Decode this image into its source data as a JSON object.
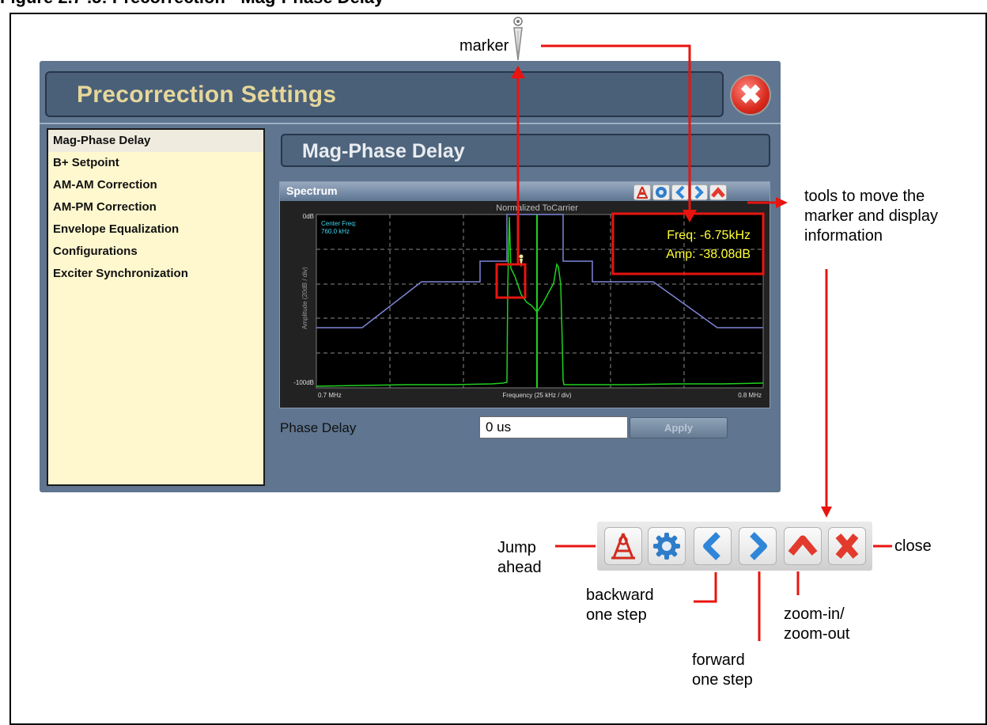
{
  "figure": {
    "title": "Figure 2.7 .5: Precorrection - Mag-Phase Delay"
  },
  "window": {
    "title": "Precorrection Settings",
    "close_glyph": "✖"
  },
  "menu": {
    "items": [
      {
        "label": "Mag-Phase Delay",
        "active": true
      },
      {
        "label": "B+ Setpoint"
      },
      {
        "label": "AM-AM Correction"
      },
      {
        "label": "AM-PM Correction"
      },
      {
        "label": "Envelope Equalization"
      },
      {
        "label": "Configurations"
      },
      {
        "label": "Exciter Synchronization"
      }
    ]
  },
  "section": {
    "title": "Mag-Phase Delay"
  },
  "spectrum": {
    "panel_title": "Spectrum",
    "plot_title": "Normalized ToCarrier",
    "center_freq_label": "Center Freq:",
    "center_freq_value": "760.0 kHz",
    "y_top": "0dB",
    "y_bottom": "-100dB",
    "y_axis_label": "Amplitude (20dB / div)",
    "x_left": "0.7 MHz",
    "x_right": "0.8 MHz",
    "x_axis_label": "Frequency (25 kHz / div)",
    "marker_freq": "Freq: -6.75kHz",
    "marker_amp": "Amp: -38.08dB"
  },
  "phase_delay": {
    "label": "Phase Delay",
    "value": "0 us",
    "apply_label": "Apply"
  },
  "annotations": {
    "marker": "marker",
    "tools": [
      "tools to move the",
      "marker and display",
      "information"
    ],
    "jump": [
      "Jump",
      "ahead"
    ],
    "backward": [
      "backward",
      "one step"
    ],
    "forward": [
      "forward",
      "one step"
    ],
    "zoom": [
      "zoom-in/",
      "zoom-out"
    ],
    "close": "close"
  },
  "colors": {
    "annotation": "#e8140f",
    "trace_green": "#20d020",
    "trace_blue": "#7f86d8",
    "readout_yellow": "#ffff33"
  }
}
